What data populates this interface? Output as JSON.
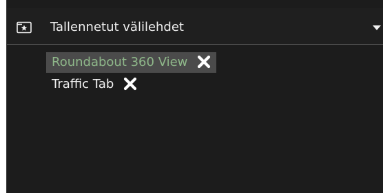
{
  "panel": {
    "title": "Tallennetut välilehdet",
    "title_icon": "star-folder-icon",
    "dropdown_icon": "chevron-down-icon"
  },
  "tabs": [
    {
      "label": "Roundabout 360 View",
      "selected": true,
      "close_icon": "close-icon"
    },
    {
      "label": "Traffic Tab",
      "selected": false,
      "close_icon": "close-icon"
    }
  ],
  "colors": {
    "panel_bg": "#1c1c1c",
    "selected_bg": "#4b4b4b",
    "selected_text": "#8fb88a",
    "text": "#f2f2f2"
  }
}
